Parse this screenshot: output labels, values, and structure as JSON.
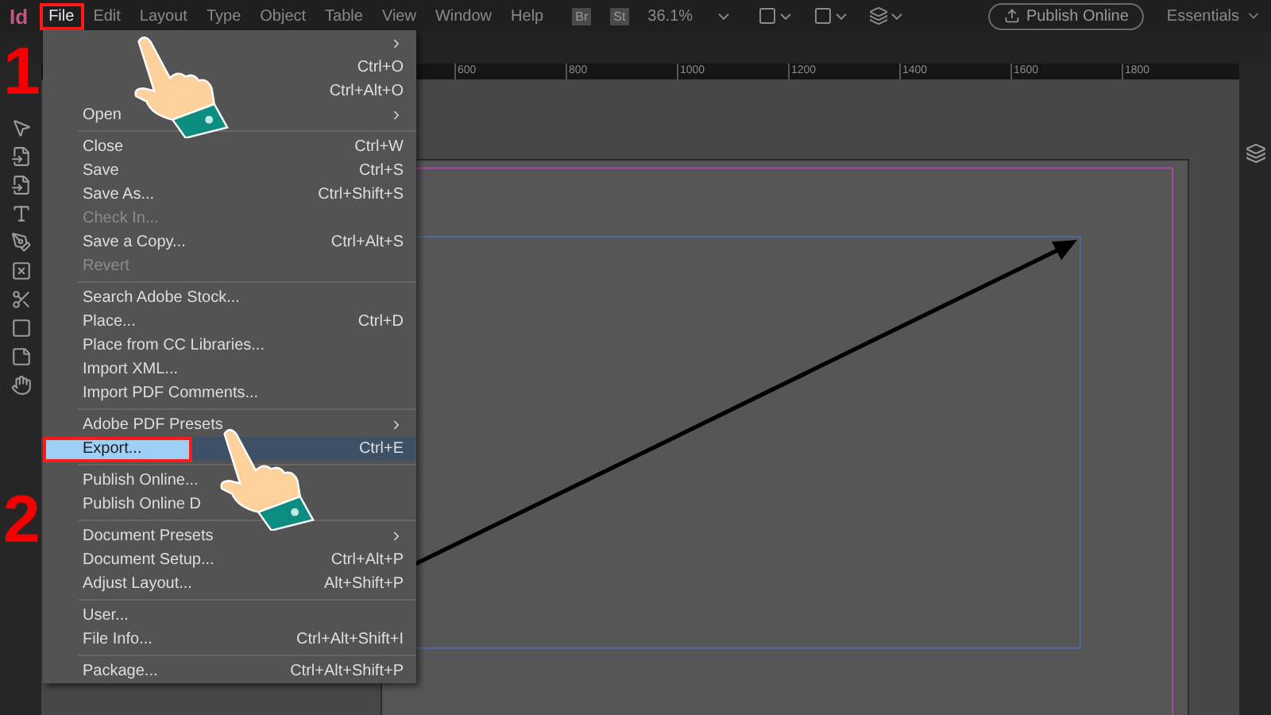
{
  "app": {
    "logo": "Id"
  },
  "menubar": [
    {
      "label": "File",
      "selected": true
    },
    {
      "label": "Edit",
      "selected": false
    },
    {
      "label": "Layout",
      "selected": false
    },
    {
      "label": "Type",
      "selected": false
    },
    {
      "label": "Object",
      "selected": false
    },
    {
      "label": "Table",
      "selected": false
    },
    {
      "label": "View",
      "selected": false
    },
    {
      "label": "Window",
      "selected": false
    },
    {
      "label": "Help",
      "selected": false
    }
  ],
  "toolbar": {
    "bridge": "Br",
    "stock": "St",
    "zoom": "36.1%",
    "publish": "Publish Online",
    "workspace": "Essentials"
  },
  "ruler": [
    "600",
    "800",
    "1000",
    "1200",
    "1400",
    "1600",
    "1800"
  ],
  "file_menu": [
    {
      "kind": "item",
      "submenu": true,
      "disabled": false,
      "selected": false
    },
    {
      "kind": "item",
      "shortcut": "Ctrl+O",
      "submenu": false,
      "disabled": false,
      "selected": false
    },
    {
      "kind": "item",
      "shortcut": "Ctrl+Alt+O",
      "submenu": false,
      "disabled": false,
      "selected": false
    },
    {
      "kind": "item",
      "label": "Open",
      "submenu": true,
      "disabled": false,
      "selected": false
    },
    {
      "kind": "separator"
    },
    {
      "kind": "item",
      "label": "Close",
      "shortcut": "Ctrl+W",
      "submenu": false,
      "disabled": false,
      "selected": false
    },
    {
      "kind": "item",
      "label": "Save",
      "shortcut": "Ctrl+S",
      "submenu": false,
      "disabled": false,
      "selected": false
    },
    {
      "kind": "item",
      "label": "Save As...",
      "shortcut": "Ctrl+Shift+S",
      "submenu": false,
      "disabled": false,
      "selected": false
    },
    {
      "kind": "item",
      "label": "Check In...",
      "submenu": false,
      "disabled": true,
      "selected": false
    },
    {
      "kind": "item",
      "label": "Save a Copy...",
      "shortcut": "Ctrl+Alt+S",
      "submenu": false,
      "disabled": false,
      "selected": false
    },
    {
      "kind": "item",
      "label": "Revert",
      "submenu": false,
      "disabled": true,
      "selected": false
    },
    {
      "kind": "separator"
    },
    {
      "kind": "item",
      "label": "Search Adobe Stock...",
      "submenu": false,
      "disabled": false,
      "selected": false
    },
    {
      "kind": "item",
      "label": "Place...",
      "shortcut": "Ctrl+D",
      "submenu": false,
      "disabled": false,
      "selected": false
    },
    {
      "kind": "item",
      "label": "Place from CC Libraries...",
      "submenu": false,
      "disabled": false,
      "selected": false
    },
    {
      "kind": "item",
      "label": "Import XML...",
      "submenu": false,
      "disabled": false,
      "selected": false
    },
    {
      "kind": "item",
      "label": "Import PDF Comments...",
      "submenu": false,
      "disabled": false,
      "selected": false
    },
    {
      "kind": "separator"
    },
    {
      "kind": "item",
      "label": "Adobe PDF Presets",
      "submenu": true,
      "disabled": false,
      "selected": false
    },
    {
      "kind": "item",
      "label": "Export...",
      "shortcut": "Ctrl+E",
      "submenu": false,
      "disabled": false,
      "selected": true
    },
    {
      "kind": "separator"
    },
    {
      "kind": "item",
      "label": "Publish Online...",
      "submenu": false,
      "disabled": false,
      "selected": false
    },
    {
      "kind": "item",
      "label": "Publish Online D",
      "submenu": false,
      "disabled": false,
      "selected": false
    },
    {
      "kind": "separator"
    },
    {
      "kind": "item",
      "label": "Document Presets",
      "submenu": true,
      "disabled": false,
      "selected": false
    },
    {
      "kind": "item",
      "label": "Document Setup...",
      "shortcut": "Ctrl+Alt+P",
      "submenu": false,
      "disabled": false,
      "selected": false
    },
    {
      "kind": "item",
      "label": "Adjust Layout...",
      "shortcut": "Alt+Shift+P",
      "submenu": false,
      "disabled": false,
      "selected": false
    },
    {
      "kind": "separator"
    },
    {
      "kind": "item",
      "label": "User...",
      "submenu": false,
      "disabled": false,
      "selected": false
    },
    {
      "kind": "item",
      "label": "File Info...",
      "shortcut": "Ctrl+Alt+Shift+I",
      "submenu": false,
      "disabled": false,
      "selected": false
    },
    {
      "kind": "separator"
    },
    {
      "kind": "item",
      "label": "Package...",
      "shortcut": "Ctrl+Alt+Shift+P",
      "submenu": false,
      "disabled": false,
      "selected": false
    }
  ],
  "annotations": [
    {
      "label": "1"
    },
    {
      "label": "2"
    }
  ]
}
